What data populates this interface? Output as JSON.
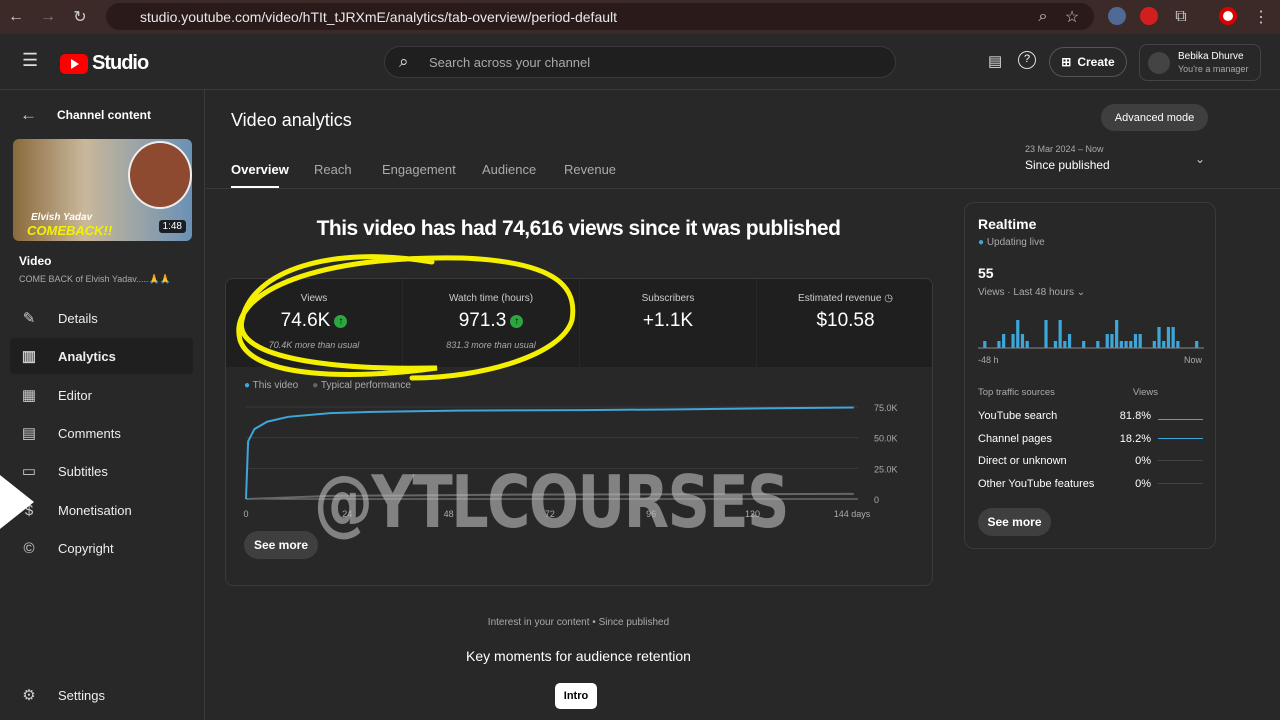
{
  "browser": {
    "url": "studio.youtube.com/video/hTIt_tJRXmE/analytics/tab-overview/period-default"
  },
  "header": {
    "logo_text": "Studio",
    "search_placeholder": "Search across your channel",
    "create_label": "Create",
    "account_name": "Bebika Dhurve",
    "account_role": "You're a manager"
  },
  "sidebar": {
    "back_label": "Channel content",
    "thumb_text1": "Elvish Yadav",
    "thumb_text2": "COMEBACK!!",
    "duration": "1:48",
    "video_heading": "Video",
    "video_title": "COME BACK of Elvish Yadav.....🙏🙏",
    "items": [
      {
        "label": "Details",
        "icon": "pencil"
      },
      {
        "label": "Analytics",
        "icon": "bar-chart"
      },
      {
        "label": "Editor",
        "icon": "film"
      },
      {
        "label": "Comments",
        "icon": "comment"
      },
      {
        "label": "Subtitles",
        "icon": "subtitles"
      },
      {
        "label": "Monetisation",
        "icon": "dollar"
      },
      {
        "label": "Copyright",
        "icon": "copyright"
      }
    ],
    "settings_label": "Settings"
  },
  "main": {
    "title": "Video analytics",
    "advanced_label": "Advanced mode",
    "tabs": [
      "Overview",
      "Reach",
      "Engagement",
      "Audience",
      "Revenue"
    ],
    "period_range": "23 Mar 2024 – Now",
    "period_label": "Since published",
    "headline": "This video has had 74,616 views since it was published",
    "metrics": [
      {
        "label": "Views",
        "value": "74.6K",
        "sub": "70.4K more than usual"
      },
      {
        "label": "Watch time (hours)",
        "value": "971.3",
        "sub": "831.3 more than usual"
      },
      {
        "label": "Subscribers",
        "value": "+1.1K"
      },
      {
        "label": "Estimated revenue",
        "value": "$10.58"
      }
    ],
    "see_more": "See more",
    "interest": "Interest in your content • Since published",
    "key_moments": "Key moments for audience retention",
    "intro_label": "Intro"
  },
  "chart_data": {
    "type": "line",
    "legend": [
      "This video",
      "Typical performance"
    ],
    "x_ticks": [
      "0",
      "24",
      "48",
      "72",
      "96",
      "120",
      "144 days"
    ],
    "y_ticks": [
      "0",
      "25.0K",
      "50.0K",
      "75.0K"
    ],
    "xlim": [
      0,
      145
    ],
    "ylim": [
      0,
      75000
    ],
    "series": [
      {
        "name": "This video",
        "color": "#3ea6d8",
        "x": [
          0,
          0.5,
          2,
          5,
          10,
          20,
          30,
          50,
          80,
          100,
          120,
          144
        ],
        "y": [
          0,
          47000,
          57000,
          63000,
          67000,
          70000,
          71000,
          72000,
          72500,
          73000,
          73800,
          74600
        ]
      },
      {
        "name": "Typical performance",
        "color": "#666666",
        "x": [
          0,
          20,
          60,
          144
        ],
        "y": [
          0,
          2500,
          3500,
          4200
        ]
      }
    ]
  },
  "realtime": {
    "title": "Realtime",
    "status": "Updating live",
    "count": "55",
    "period": "Views · Last 48 hours",
    "left": "-48 h",
    "right": "Now",
    "bars": [
      0,
      1,
      0,
      0,
      1,
      2,
      0,
      2,
      4,
      2,
      1,
      0,
      0,
      0,
      4,
      0,
      1,
      4,
      1,
      2,
      0,
      0,
      1,
      0,
      0,
      1,
      0,
      2,
      2,
      4,
      1,
      1,
      1,
      2,
      2,
      0,
      0,
      1,
      3,
      1,
      3,
      3,
      1,
      0,
      0,
      0,
      1,
      0
    ],
    "sources_header": "Top traffic sources",
    "views_header": "Views",
    "sources": [
      {
        "name": "YouTube search",
        "pct": "81.8%"
      },
      {
        "name": "Channel pages",
        "pct": "18.2%"
      },
      {
        "name": "Direct or unknown",
        "pct": "0%"
      },
      {
        "name": "Other YouTube features",
        "pct": "0%"
      }
    ],
    "see_more": "See more"
  },
  "watermark": "@YTLCOURSES",
  "colors": {
    "accent": "#3ea6d8",
    "up": "#2ba640",
    "annotation": "#f5f000"
  }
}
